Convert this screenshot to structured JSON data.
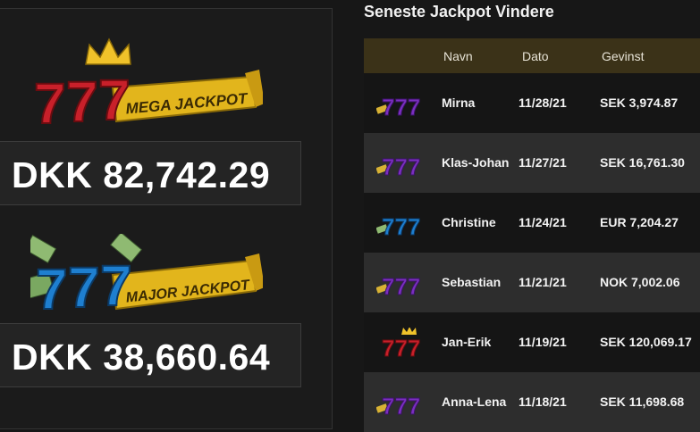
{
  "jackpots": [
    {
      "logo_text": "MEGA JACKPOT",
      "logo_icon": "mega-jackpot-logo-icon",
      "amount": "DKK 82,742.29"
    },
    {
      "logo_text": "MAJOR JACKPOT",
      "logo_icon": "major-jackpot-logo-icon",
      "amount": "DKK 38,660.64"
    }
  ],
  "winners": {
    "title": "Seneste Jackpot Vindere",
    "columns": {
      "name": "Navn",
      "date": "Dato",
      "win": "Gevinst"
    },
    "rows": [
      {
        "icon": "purple-777-icon",
        "name": "Mirna",
        "date": "11/28/21",
        "win": "SEK 3,974.87"
      },
      {
        "icon": "purple-777-icon",
        "name": "Klas-Johan",
        "date": "11/27/21",
        "win": "SEK 16,761.30"
      },
      {
        "icon": "blue-777-icon",
        "name": "Christine",
        "date": "11/24/21",
        "win": "EUR 7,204.27"
      },
      {
        "icon": "purple-777-icon",
        "name": "Sebastian",
        "date": "11/21/21",
        "win": "NOK 7,002.06"
      },
      {
        "icon": "red-777-crown-icon",
        "name": "Jan-Erik",
        "date": "11/19/21",
        "win": "SEK 120,069.17"
      },
      {
        "icon": "purple-777-icon",
        "name": "Anna-Lena",
        "date": "11/18/21",
        "win": "SEK 11,698.68"
      }
    ]
  },
  "colors": {
    "header_bg": "#3b3218",
    "row_dark": "#151515",
    "row_light": "#2d2d2d",
    "mega_red": "#c8202a",
    "major_blue": "#1e7fd0",
    "gold": "#e8c020",
    "purple": "#7b2fc0"
  }
}
